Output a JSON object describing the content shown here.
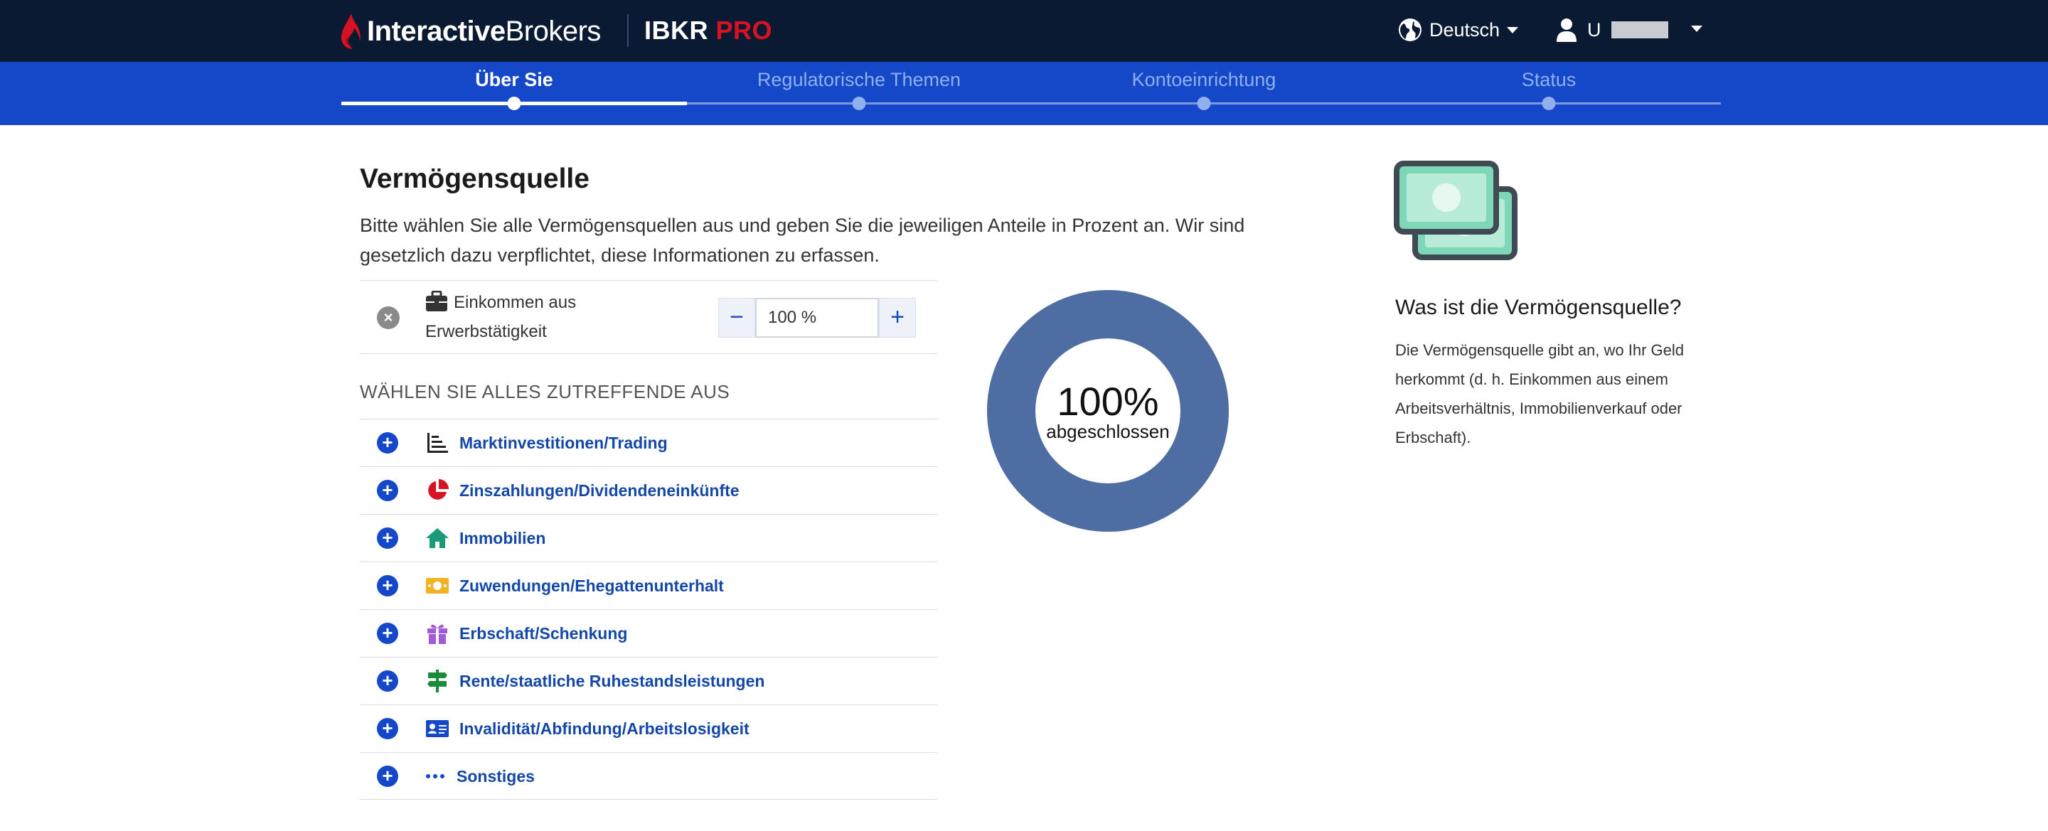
{
  "header": {
    "brand_bold": "Interactive",
    "brand_rest": "Brokers",
    "product": "IBKR",
    "product_accent": "PRO",
    "language": "Deutsch",
    "user_initial": "U",
    "colors": {
      "topbar": "#0a1a33",
      "stepbar": "#1448c8",
      "accent_red": "#d81222"
    }
  },
  "steps": [
    {
      "label": "Über Sie",
      "active": true
    },
    {
      "label": "Regulatorische Themen",
      "active": false
    },
    {
      "label": "Kontoeinrichtung",
      "active": false
    },
    {
      "label": "Status",
      "active": false
    }
  ],
  "main": {
    "title": "Vermögensquelle",
    "description": "Bitte wählen Sie alle Vermögensquellen aus und geben Sie die jeweiligen Anteile in Prozent an. Wir sind gesetzlich dazu verpflichtet, diese Informationen zu erfassen.",
    "selected": {
      "label": "Einkommen aus Erwerbstätigkeit",
      "icon": "briefcase-icon",
      "value": "100 %",
      "minus": "−",
      "plus": "+"
    },
    "select_all_heading": "WÄHLEN SIE ALLES ZUTREFFENDE AUS",
    "options": [
      {
        "label": "Marktinvestitionen/Trading",
        "icon": "bar-chart-icon",
        "color": "#222222"
      },
      {
        "label": "Zinszahlungen/Dividendeneinkünfte",
        "icon": "pie-chart-icon",
        "color": "#d81222"
      },
      {
        "label": "Immobilien",
        "icon": "home-icon",
        "color": "#1a9a78"
      },
      {
        "label": "Zuwendungen/Ehegattenunterhalt",
        "icon": "money-icon",
        "color": "#f2b322"
      },
      {
        "label": "Erbschaft/Schenkung",
        "icon": "gift-icon",
        "color": "#a45ad4"
      },
      {
        "label": "Rente/staatliche Ruhestandsleistungen",
        "icon": "signpost-icon",
        "color": "#1b8a3a"
      },
      {
        "label": "Invalidität/Abfindung/Arbeitslosigkeit",
        "icon": "id-card-icon",
        "color": "#1448c8"
      },
      {
        "label": "Sonstiges",
        "icon": "more-dots-icon",
        "color": "#1448c8"
      }
    ],
    "add_symbol": "+",
    "remove_symbol": "×"
  },
  "progress": {
    "percent_text": "100%",
    "label": "abgeschlossen",
    "fraction": 1.0,
    "color": "#4e6da3"
  },
  "info": {
    "icon": "cash-notes-icon",
    "title": "Was ist die Vermögensquelle?",
    "text": "Die Vermögensquelle gibt an, wo Ihr Geld herkommt (d. h. Einkommen aus einem Arbeitsverhältnis, Immobilienverkauf oder Erbschaft)."
  }
}
